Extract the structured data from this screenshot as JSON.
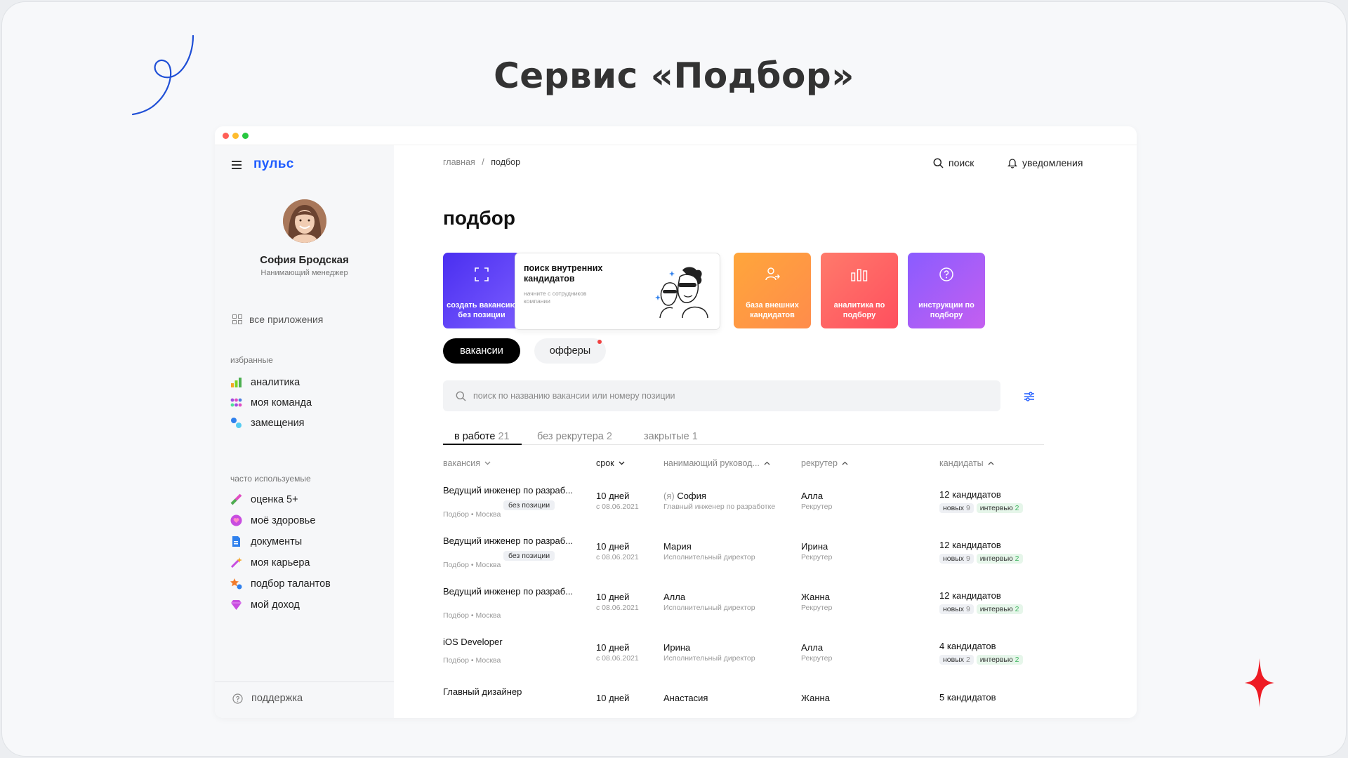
{
  "slide": {
    "title": "Сервис «Подбор»"
  },
  "app": {
    "logo": "пульс"
  },
  "sidebar": {
    "user": {
      "name": "София Бродская",
      "role": "Нанимающий менеджер"
    },
    "all_apps": "все приложения",
    "favorites_title": "избранные",
    "favorites": [
      {
        "label": "аналитика",
        "icon": "analytics-icon"
      },
      {
        "label": "моя команда",
        "icon": "team-icon"
      },
      {
        "label": "замещения",
        "icon": "substitution-icon"
      }
    ],
    "frequent_title": "часто используемые",
    "frequent": [
      {
        "label": "оценка 5+",
        "icon": "rating-icon"
      },
      {
        "label": "моё здоровье",
        "icon": "health-icon"
      },
      {
        "label": "документы",
        "icon": "document-icon"
      },
      {
        "label": "моя карьера",
        "icon": "career-icon"
      },
      {
        "label": "подбор талантов",
        "icon": "talent-icon"
      },
      {
        "label": "мой доход",
        "icon": "income-icon"
      }
    ],
    "support": "поддержка"
  },
  "header": {
    "breadcrumb": [
      "главная",
      "подбор"
    ],
    "breadcrumb_sep": "/",
    "search_label": "поиск",
    "notifications_label": "уведомления"
  },
  "page": {
    "title": "подбор"
  },
  "tiles": {
    "create": "создать вакансию без позиции",
    "internal_title": "поиск внутренних кандидатов",
    "internal_sub": "начните с сотрудников компании",
    "external": "база внешних кандидатов",
    "analytics": "аналитика по подбору",
    "instructions": "инструкции по подбору"
  },
  "pills": {
    "vacancies": "вакансии",
    "offers": "офферы"
  },
  "search": {
    "placeholder": "поиск по названию вакансии или номеру позиции"
  },
  "tabs": [
    {
      "label": "в работе",
      "count": "21"
    },
    {
      "label": "без рекрутера",
      "count": "2"
    },
    {
      "label": "закрытые",
      "count": "1"
    }
  ],
  "columns": {
    "vacancy": "вакансия",
    "deadline": "срок",
    "manager": "нанимающий руковод...",
    "recruiter": "рекрутер",
    "candidates": "кандидаты"
  },
  "rows": [
    {
      "title": "Ведущий инженер по разраб...",
      "badge": "без позиции",
      "sub": "Подбор • Москва",
      "deadline": "10 дней",
      "since": "с 08.06.2021",
      "manager_prefix": "(я) ",
      "manager": "София",
      "manager_role": "Главный инженер по разработке",
      "recruiter": "Алла",
      "recruiter_role": "Рекрутер",
      "candidates": "12 кандидатов",
      "new_label": "новых",
      "new_count": "9",
      "iv_label": "интервью",
      "iv_count": "2"
    },
    {
      "title": "Ведущий инженер по разраб...",
      "badge": "без позиции",
      "sub": "Подбор • Москва",
      "deadline": "10 дней",
      "since": "с 08.06.2021",
      "manager_prefix": "",
      "manager": "Мария",
      "manager_role": "Исполнительный директор",
      "recruiter": "Ирина",
      "recruiter_role": "Рекрутер",
      "candidates": "12 кандидатов",
      "new_label": "новых",
      "new_count": "9",
      "iv_label": "интервью",
      "iv_count": "2"
    },
    {
      "title": "Ведущий инженер по разраб...",
      "badge": "",
      "sub": "Подбор • Москва",
      "deadline": "10 дней",
      "since": "с 08.06.2021",
      "manager_prefix": "",
      "manager": "Алла",
      "manager_role": "Исполнительный директор",
      "recruiter": "Жанна",
      "recruiter_role": "Рекрутер",
      "candidates": "12 кандидатов",
      "new_label": "новых",
      "new_count": "9",
      "iv_label": "интервью",
      "iv_count": "2"
    },
    {
      "title": "iOS Developer",
      "badge": "",
      "sub": "Подбор • Москва",
      "deadline": "10 дней",
      "since": "с 08.06.2021",
      "manager_prefix": "",
      "manager": "Ирина",
      "manager_role": "Исполнительный директор",
      "recruiter": "Алла",
      "recruiter_role": "Рекрутер",
      "candidates": "4 кандидатов",
      "new_label": "новых",
      "new_count": "2",
      "iv_label": "интервью",
      "iv_count": "2"
    },
    {
      "title": "Главный дизайнер",
      "badge": "",
      "sub": "",
      "deadline": "10 дней",
      "since": "",
      "manager_prefix": "",
      "manager": "Анастасия",
      "manager_role": "",
      "recruiter": "Жанна",
      "recruiter_role": "",
      "candidates": "5 кандидатов",
      "new_label": "",
      "new_count": "",
      "iv_label": "",
      "iv_count": ""
    }
  ],
  "colors": {
    "brand": "#1f5cff",
    "offers_dot": "#f04040"
  }
}
